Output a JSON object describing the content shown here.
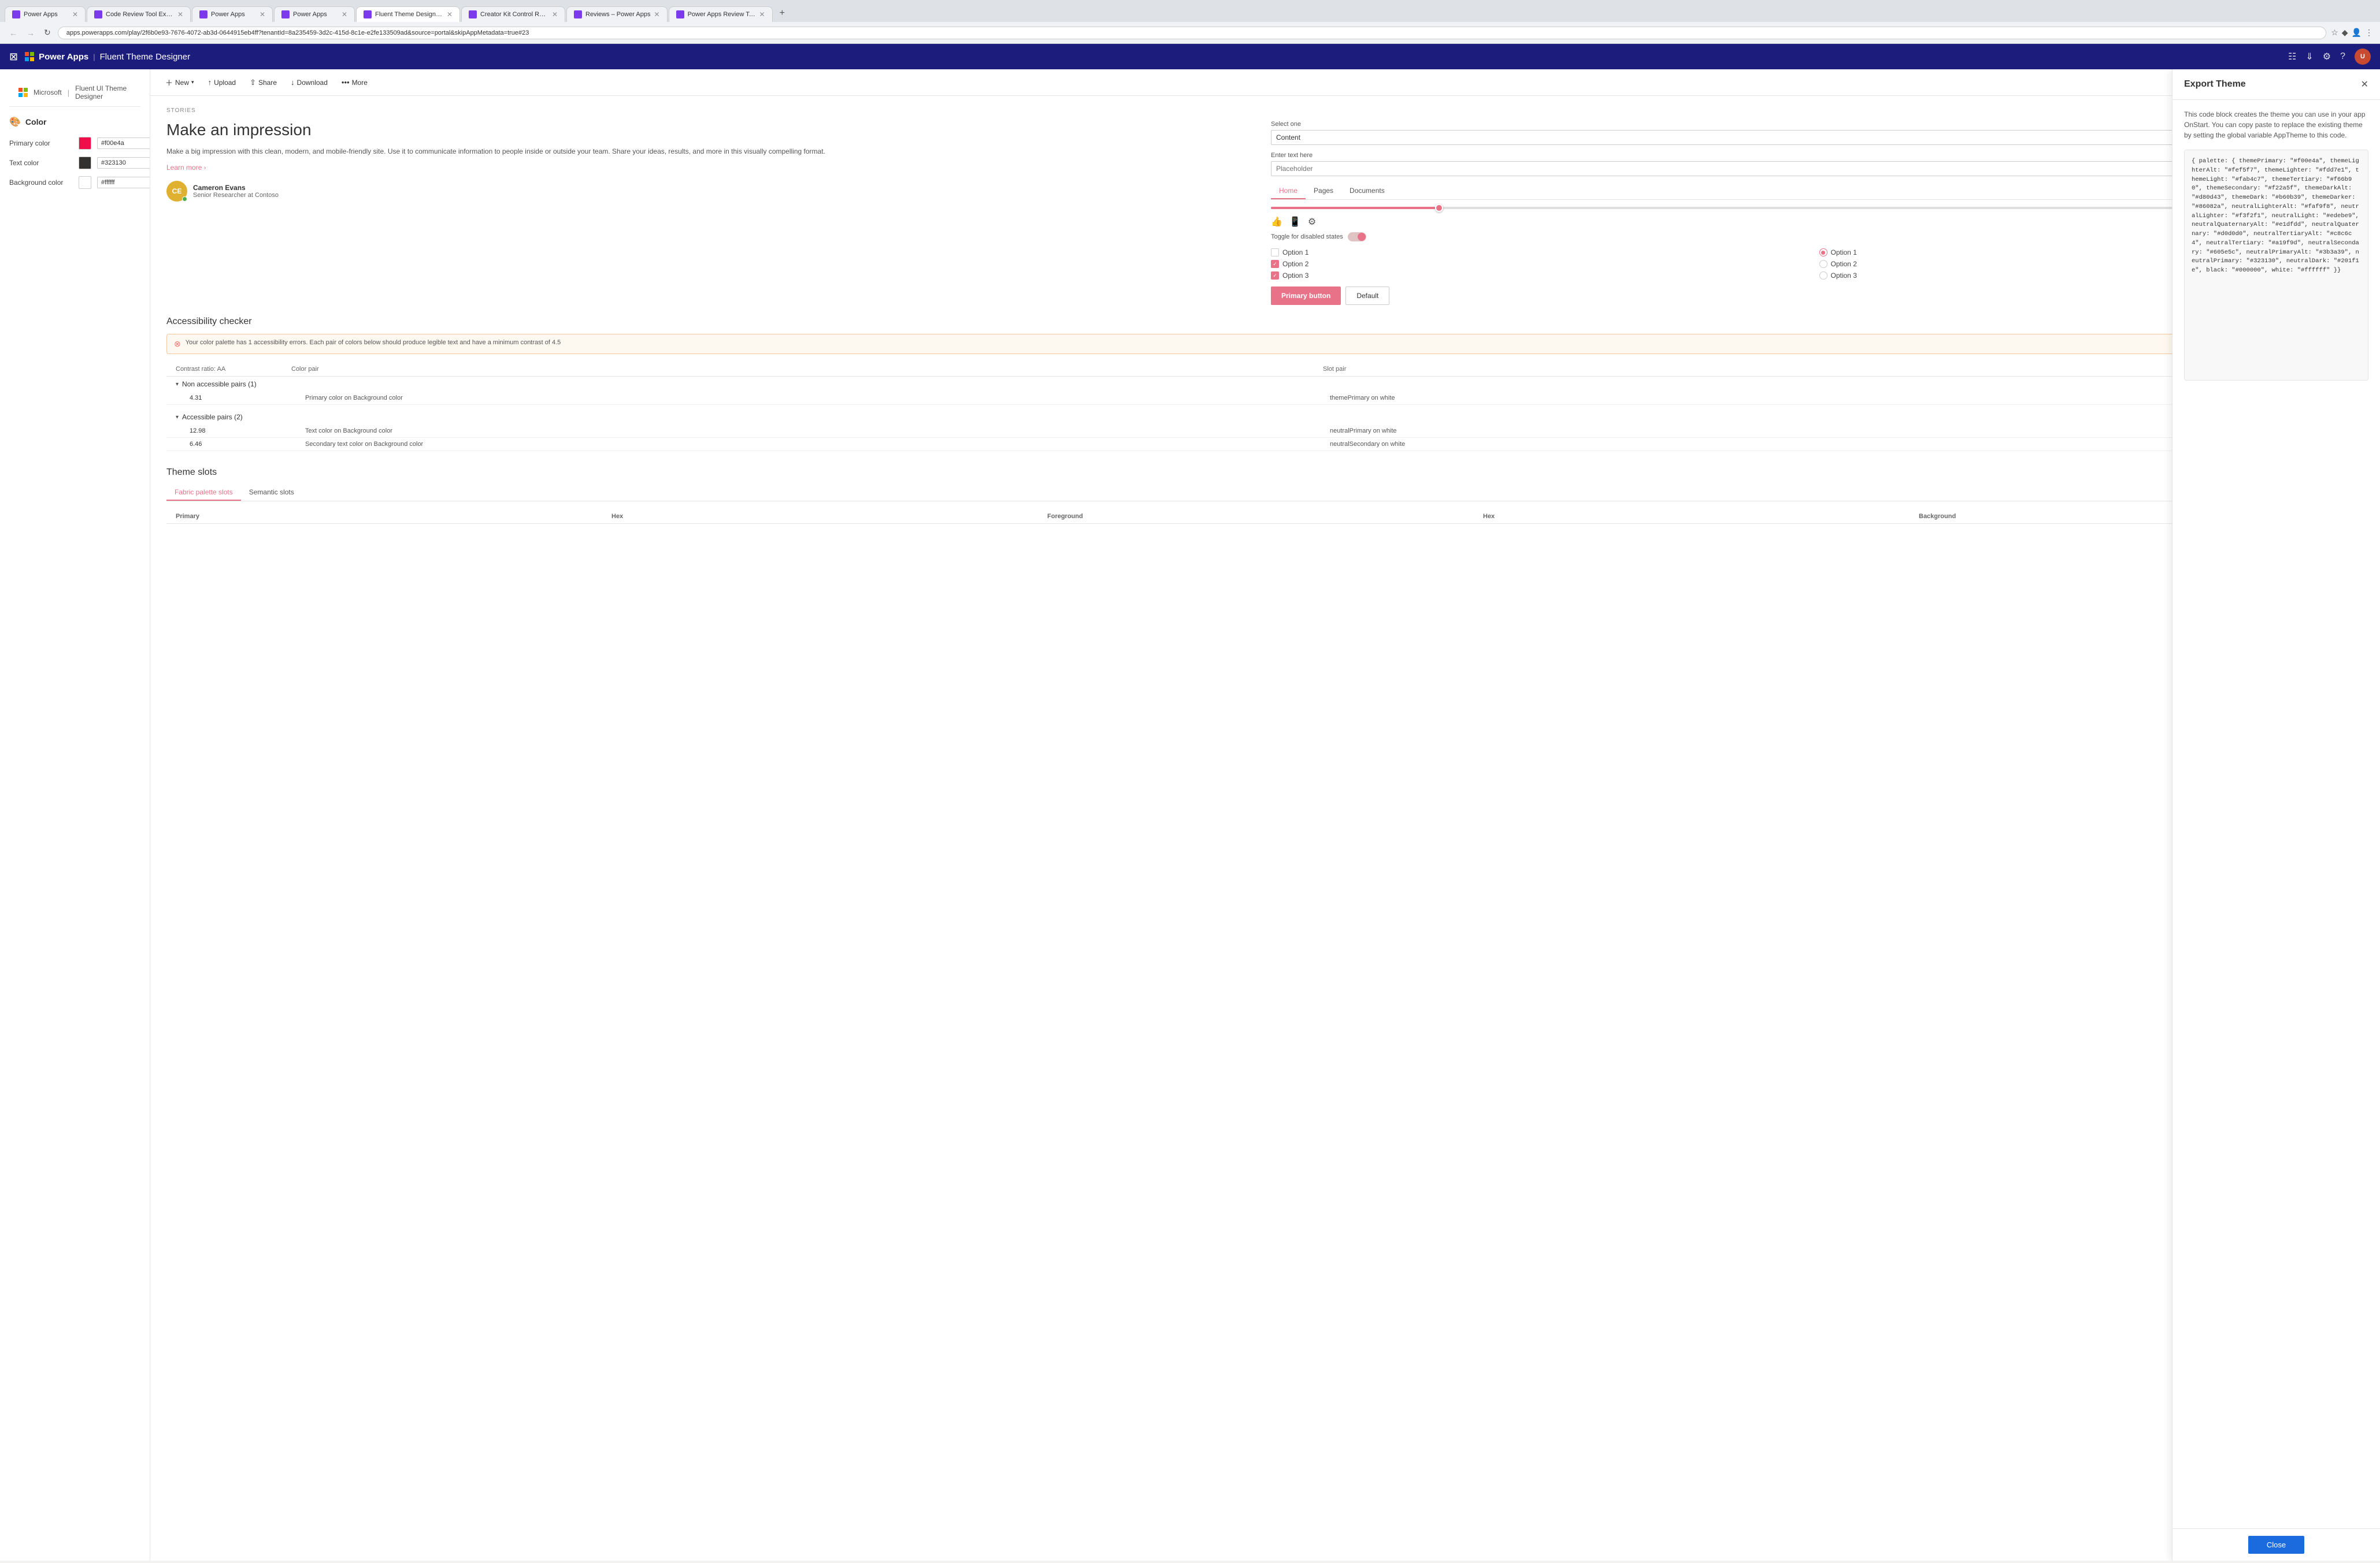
{
  "browser": {
    "tabs": [
      {
        "id": "tab1",
        "title": "Power Apps",
        "favicon_color": "#7c3aed",
        "active": false
      },
      {
        "id": "tab2",
        "title": "Code Review Tool Experim...",
        "favicon_color": "#7c3aed",
        "active": false
      },
      {
        "id": "tab3",
        "title": "Power Apps",
        "favicon_color": "#7c3aed",
        "active": false
      },
      {
        "id": "tab4",
        "title": "Power Apps",
        "favicon_color": "#7c3aed",
        "active": false
      },
      {
        "id": "tab5",
        "title": "Fluent Theme Designer - ...",
        "favicon_color": "#7c3aed",
        "active": true
      },
      {
        "id": "tab6",
        "title": "Creator Kit Control Refere...",
        "favicon_color": "#7c3aed",
        "active": false
      },
      {
        "id": "tab7",
        "title": "Reviews – Power Apps",
        "favicon_color": "#7c3aed",
        "active": false
      },
      {
        "id": "tab8",
        "title": "Power Apps Review Tool ...",
        "favicon_color": "#7c3aed",
        "active": false
      }
    ],
    "url": "apps.powerapps.com/play/2f6b0e93-7676-4072-ab3d-0644915eb4ff?tenantId=8a235459-3d2c-415d-8c1e-e2fe133509ad&source=portal&skipAppMetadata=true#23",
    "new_tab_label": "+"
  },
  "header": {
    "app_name": "Power Apps",
    "divider": "|",
    "sub_name": "Fluent Theme Designer",
    "icons": [
      "grid",
      "download",
      "settings",
      "help"
    ],
    "avatar_initials": "U"
  },
  "ms_header": {
    "company": "Microsoft",
    "divider": "|",
    "app_name": "Fluent UI Theme Designer"
  },
  "left_panel": {
    "section_title": "Color",
    "colors": [
      {
        "label": "Primary color",
        "value": "#f00e4a",
        "swatch": "#f00e4a"
      },
      {
        "label": "Text color",
        "value": "#323130",
        "swatch": "#323130"
      },
      {
        "label": "Background color",
        "value": "#ffffff",
        "swatch": "#ffffff"
      }
    ]
  },
  "toolbar": {
    "new_label": "New",
    "upload_label": "Upload",
    "share_label": "Share",
    "download_label": "Download",
    "more_label": "More"
  },
  "preview": {
    "stories_label": "STORIES",
    "headline": "Make an impression",
    "body_text": "Make a big impression with this clean, modern, and mobile-friendly site. Use it to communicate information to people inside or outside your team. Share your ideas, results, and more in this visually compelling format.",
    "learn_more": "Learn more",
    "avatar_initials": "CE",
    "avatar_name": "Cameron Evans",
    "avatar_title": "Senior Researcher at Contoso",
    "select_label": "Select one",
    "select_value": "Content",
    "text_input_label": "Enter text here",
    "text_input_placeholder": "Placeholder",
    "toggle_label": "Toggle for disabled states",
    "nav_tabs": [
      "Home",
      "Pages",
      "Documents"
    ],
    "active_nav_tab": "Home",
    "checkboxes": [
      {
        "label": "Option 1",
        "checked": false
      },
      {
        "label": "Option 2",
        "checked": true
      },
      {
        "label": "Option 3",
        "checked": true
      }
    ],
    "radios": [
      {
        "label": "Option 1",
        "checked": true
      },
      {
        "label": "Option 2",
        "checked": false
      },
      {
        "label": "Option 3",
        "checked": false
      }
    ],
    "primary_button_label": "Primary button",
    "default_button_label": "Default"
  },
  "accessibility": {
    "section_title": "Accessibility checker",
    "warning_text": "Your color palette has 1 accessibility errors. Each pair of colors below should produce legible text and have a minimum contrast of 4.5",
    "table_headers": [
      "Contrast ratio: AA",
      "Color pair",
      "Slot pair"
    ],
    "non_accessible_group": "Non accessible pairs (1)",
    "non_accessible_rows": [
      {
        "ratio": "4.31",
        "color_pair": "Primary color on Background color",
        "slot_pair": "themePrimary on white"
      }
    ],
    "accessible_group": "Accessible pairs (2)",
    "accessible_rows": [
      {
        "ratio": "12.98",
        "color_pair": "Text color on Background color",
        "slot_pair": "neutralPrimary on white"
      },
      {
        "ratio": "6.46",
        "color_pair": "Secondary text color on Background color",
        "slot_pair": "neutralSecondary on white"
      }
    ]
  },
  "theme_slots": {
    "section_title": "Theme slots",
    "tabs": [
      "Fabric palette slots",
      "Semantic slots"
    ],
    "active_tab": "Fabric palette slots",
    "table_headers": [
      "Primary",
      "Hex",
      "Foreground",
      "Hex",
      "Background"
    ]
  },
  "export_panel": {
    "title": "Export Theme",
    "description": "This code block creates the theme you can use in your app OnStart. You can copy paste to replace the existing theme by setting the global variable AppTheme to this code.",
    "code": "{ palette: { themePrimary: \"#f00e4a\", themeLighterAlt: \"#fef5f7\", themeLighter: \"#fdd7e1\", themeLight: \"#fab4c7\", themeTertiary: \"#f66b90\", themeSecondary: \"#f22a5f\", themeDarkAlt: \"#d80d43\", themeDark: \"#b60b39\", themeDarker: \"#86082a\", neutralLighterAlt: \"#faf9f8\", neutralLighter: \"#f3f2f1\", neutralLight: \"#edebe9\", neutralQuaternaryAlt: \"#e1dfdd\", neutralQuaternary: \"#d0d0d0\", neutralTertiaryAlt: \"#c8c6c4\", neutralTertiary: \"#a19f9d\", neutralSecondary: \"#605e5c\", neutralPrimaryAlt: \"#3b3a39\", neutralPrimary: \"#323130\", neutralDark: \"#201f1e\", black: \"#000000\", white: \"#ffffff\" }}",
    "close_label": "Close"
  }
}
